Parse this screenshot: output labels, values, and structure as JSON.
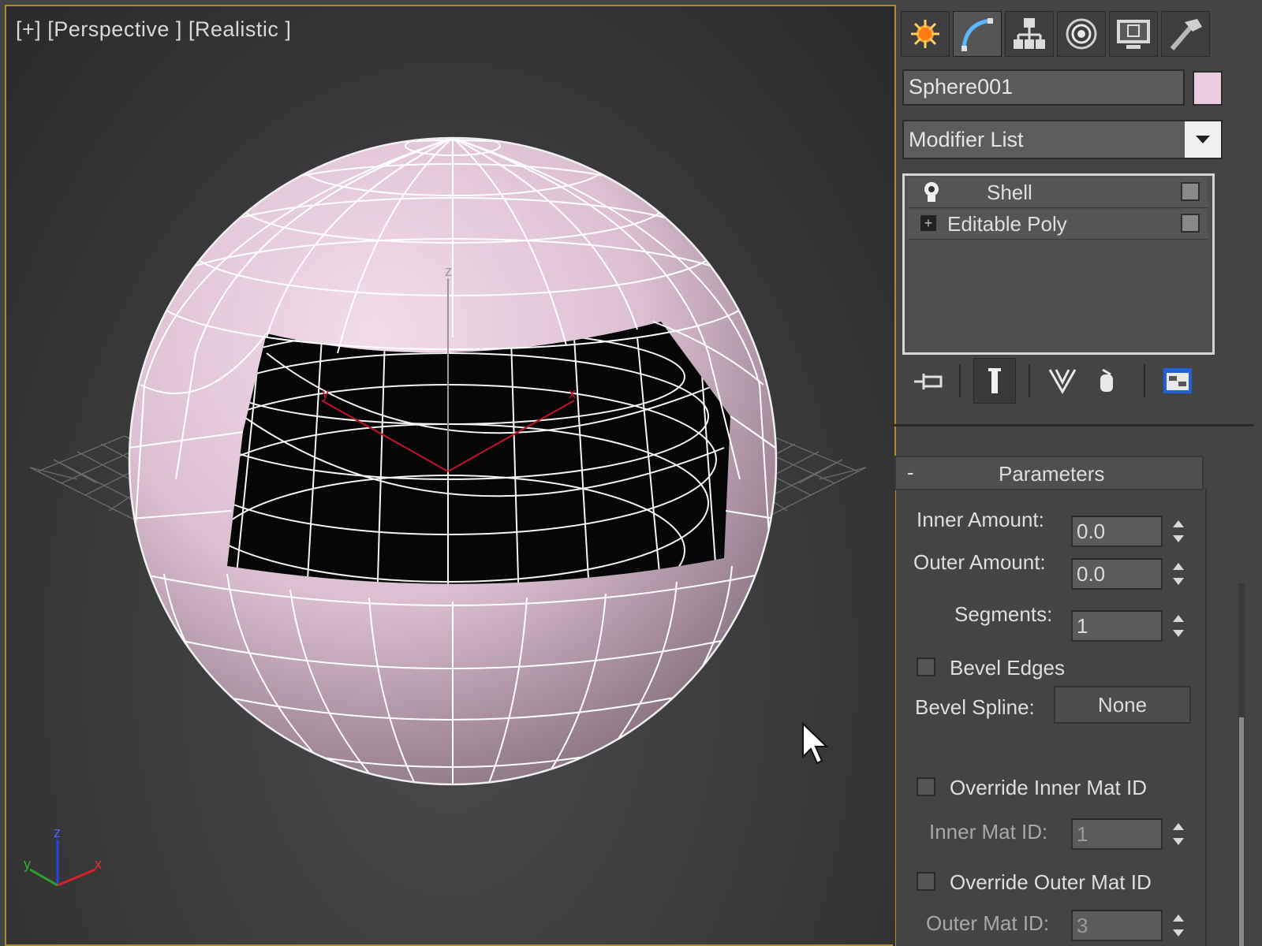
{
  "viewport": {
    "label": "[+] [Perspective ] [Realistic ]",
    "gizmo": {
      "z": "z",
      "x": "x",
      "y": "y"
    },
    "center_axes": {
      "z": "z",
      "x": "x",
      "y": "y"
    },
    "object_color": "#e6c7d9"
  },
  "command_panel": {
    "tabs": [
      {
        "icon": "create-icon",
        "active": false
      },
      {
        "icon": "modify-icon",
        "active": true
      },
      {
        "icon": "hierarchy-icon",
        "active": false
      },
      {
        "icon": "motion-icon",
        "active": false
      },
      {
        "icon": "display-icon",
        "active": false
      },
      {
        "icon": "utilities-icon",
        "active": false
      }
    ],
    "object_name": "Sphere001",
    "object_color": "#e9cce0",
    "modifier_list": "Modifier List",
    "stack": [
      {
        "label": "Shell",
        "icon": "lightbulb-icon"
      },
      {
        "label": "Editable Poly",
        "icon": "expand-plus-icon"
      }
    ],
    "toolbar_icons": [
      "pin-stack-icon",
      "show-end-result-icon",
      "make-unique-icon",
      "remove-modifier-icon",
      "configure-sets-icon"
    ]
  },
  "parameters": {
    "title": "Parameters",
    "collapse": "-",
    "inner_amount_label": "Inner Amount:",
    "inner_amount": "0.0",
    "outer_amount_label": "Outer Amount:",
    "outer_amount": "0.0",
    "segments_label": "Segments:",
    "segments": "1",
    "bevel_edges_label": "Bevel Edges",
    "bevel_edges_checked": false,
    "bevel_spline_label": "Bevel Spline:",
    "bevel_spline_value": "None",
    "override_inner_label": "Override Inner Mat ID",
    "override_inner_checked": false,
    "inner_mat_id_label": "Inner Mat ID:",
    "inner_mat_id": "1",
    "override_outer_label": "Override Outer Mat ID",
    "override_outer_checked": false,
    "outer_mat_id_label": "Outer Mat ID:",
    "outer_mat_id": "3"
  }
}
